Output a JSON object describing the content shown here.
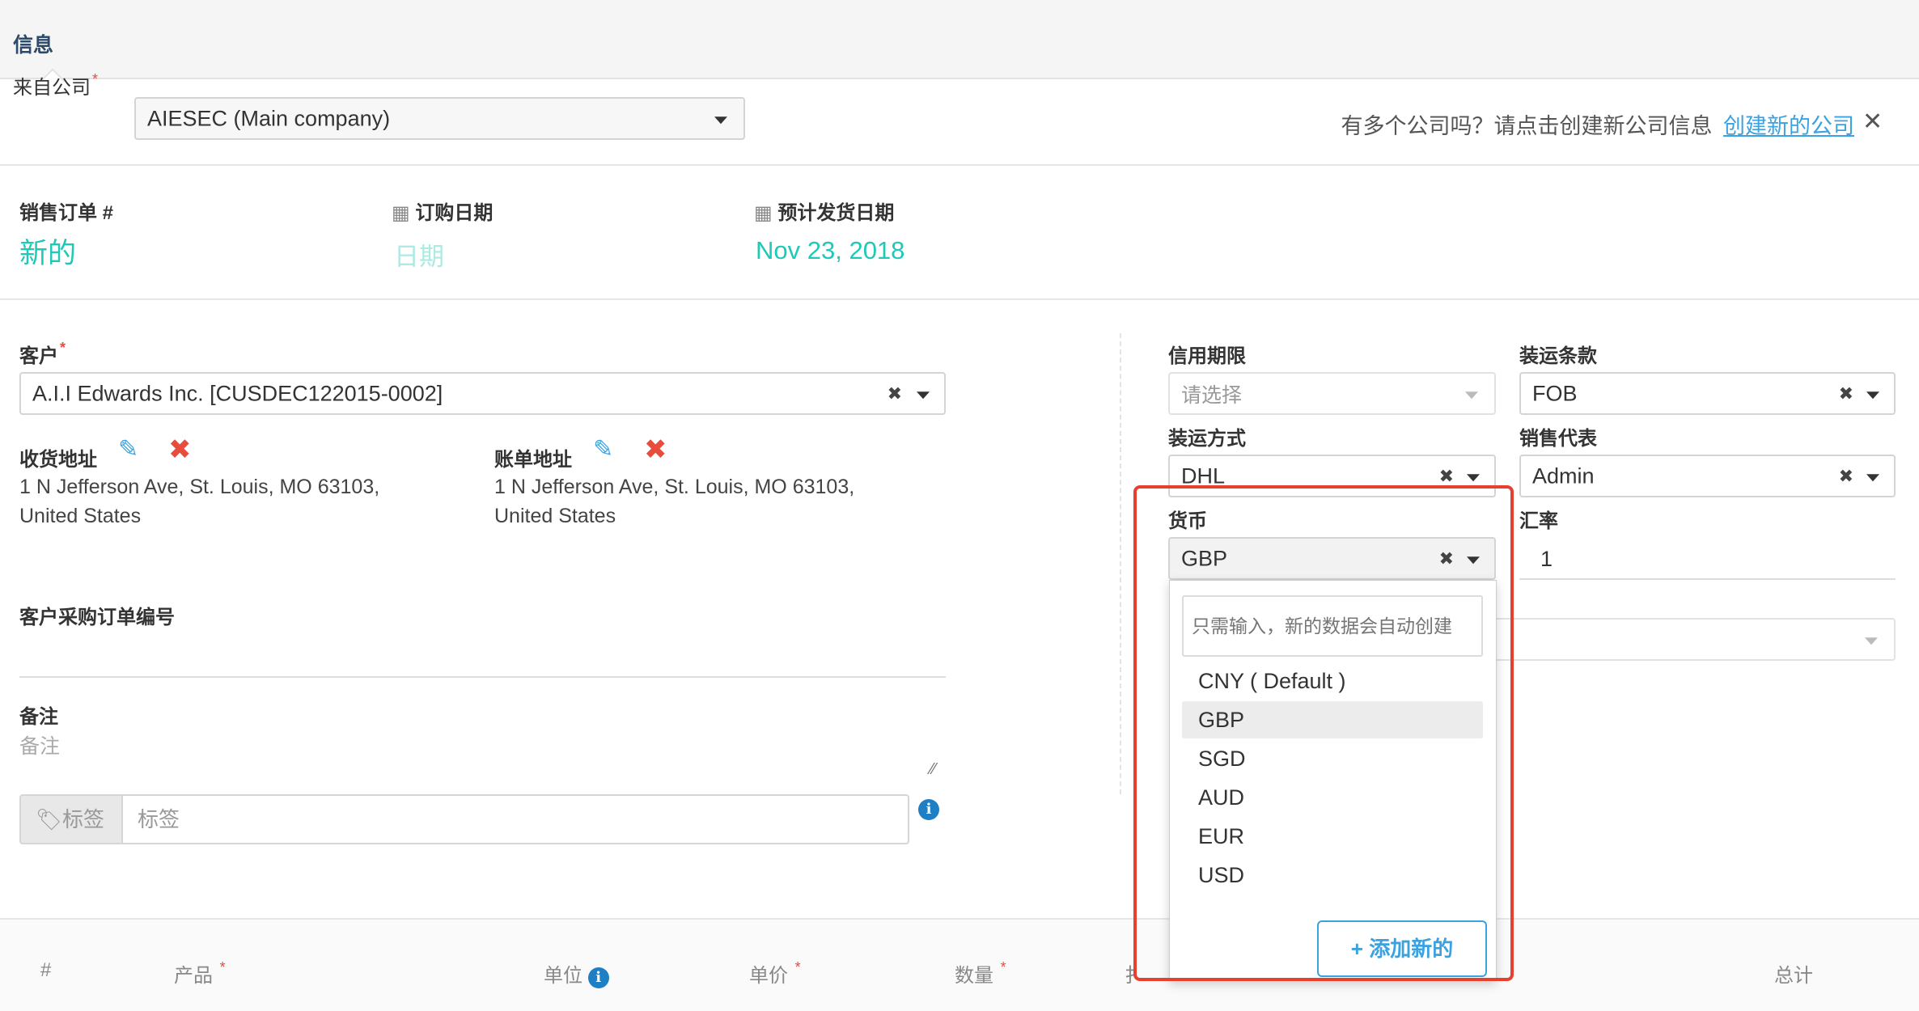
{
  "header": {
    "tab": "信息"
  },
  "company": {
    "label": "来自公司",
    "required_mark": "*",
    "value": "AIESEC (Main company)",
    "hint": "有多个公司吗？请点击创建新公司信息",
    "create_link": "创建新的公司",
    "close_icon": "close-icon"
  },
  "order": {
    "so_label": "销售订单 #",
    "so_value": "新的",
    "order_date_label": "订购日期",
    "order_date_value": "日期",
    "ship_date_label": "预计发货日期",
    "ship_date_value": "Nov 23, 2018"
  },
  "customer": {
    "label": "客户",
    "required_mark": "*",
    "value": "A.I.I Edwards Inc. [CUSDEC122015-0002]"
  },
  "shipping_address": {
    "label": "收货地址",
    "line1": "1 N Jefferson Ave, St. Louis, MO 63103,",
    "line2": "United States"
  },
  "billing_address": {
    "label": "账单地址",
    "line1": "1 N Jefferson Ave, St. Louis, MO 63103,",
    "line2": "United States"
  },
  "po": {
    "label": "客户采购订单编号"
  },
  "notes": {
    "label": "备注",
    "placeholder": "备注"
  },
  "tags": {
    "addon": "标签",
    "placeholder": "标签"
  },
  "right": {
    "credit_label": "信用期限",
    "credit_placeholder": "请选择",
    "ship_terms_label": "装运条款",
    "ship_terms_value": "FOB",
    "ship_method_label": "装运方式",
    "ship_method_value": "DHL",
    "sales_rep_label": "销售代表",
    "sales_rep_value": "Admin",
    "currency_label": "货币",
    "currency_value": "GBP",
    "rate_label": "汇率",
    "rate_value": "1"
  },
  "currency_dropdown": {
    "search_placeholder": "只需输入，新的数据会自动创建",
    "options": [
      "CNY ( Default )",
      "GBP",
      "SGD",
      "AUD",
      "EUR",
      "USD"
    ],
    "selected": "GBP",
    "add_label": "+ 添加新的"
  },
  "table": {
    "hash": "#",
    "product": "产品",
    "unit": "单位",
    "price": "单价",
    "qty": "数量",
    "discount_partial": "扌",
    "total": "总计",
    "required_mark": "*"
  },
  "colors": {
    "teal": "#1fc9b7",
    "link": "#3aa2e0",
    "danger": "#e74c3c",
    "highlight_box": "#e8402f"
  }
}
